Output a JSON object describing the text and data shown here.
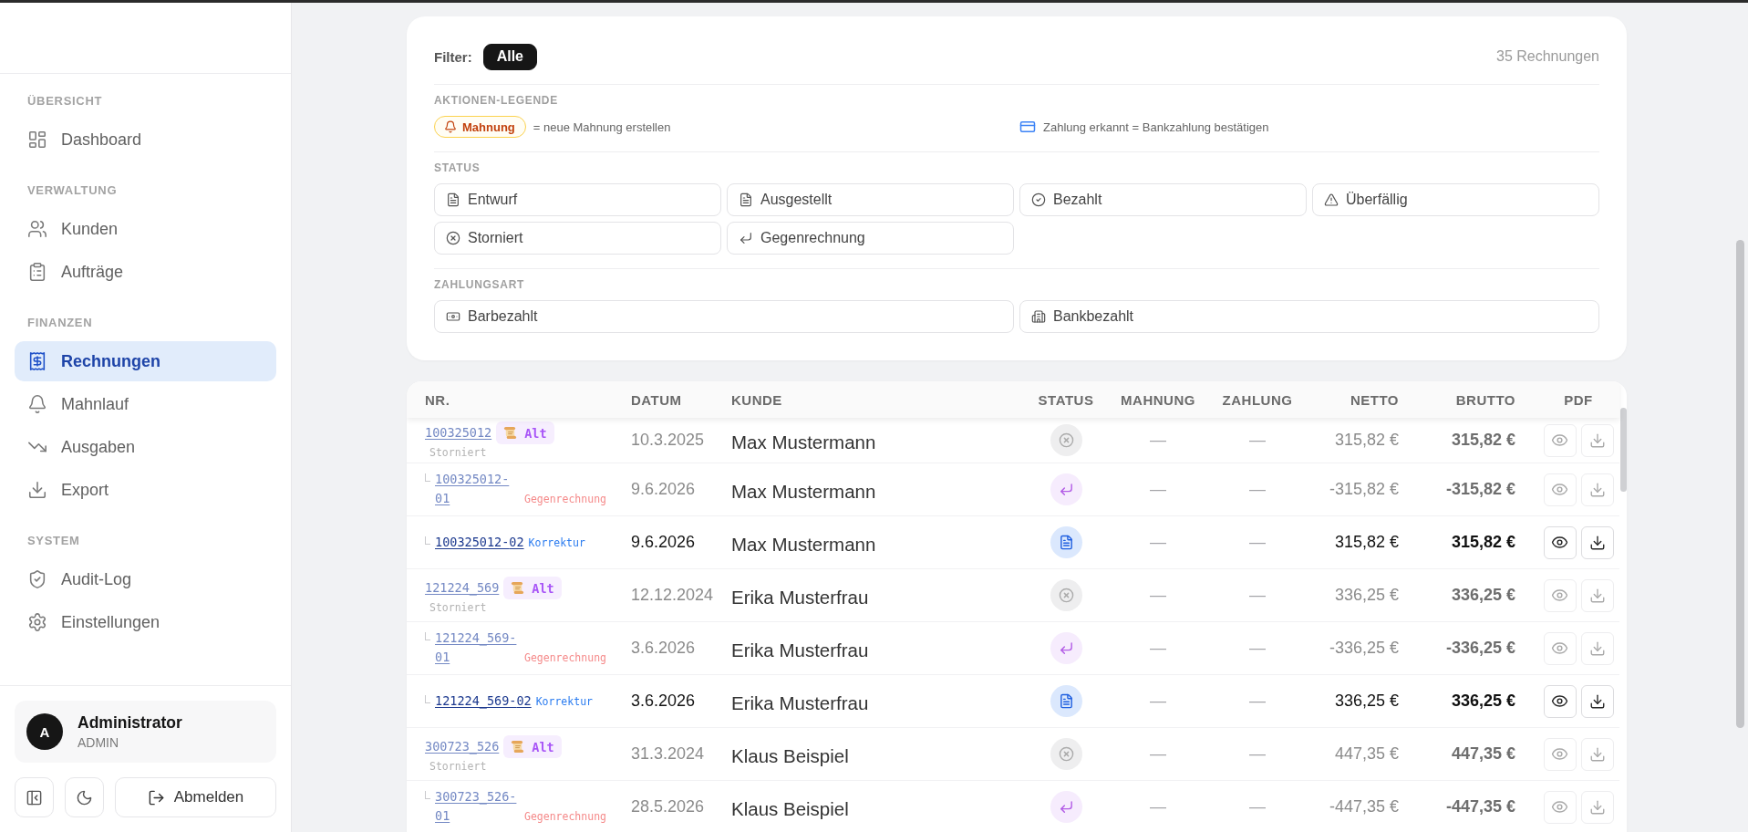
{
  "sidebar": {
    "sections": [
      {
        "label": "ÜBERSICHT",
        "items": [
          {
            "label": "Dashboard",
            "kind": "dashboard",
            "selected": false
          }
        ]
      },
      {
        "label": "VERWALTUNG",
        "items": [
          {
            "label": "Kunden",
            "kind": "customers",
            "selected": false
          },
          {
            "label": "Aufträge",
            "kind": "orders",
            "selected": false
          }
        ]
      },
      {
        "label": "FINANZEN",
        "items": [
          {
            "label": "Rechnungen",
            "kind": "invoices",
            "selected": true
          },
          {
            "label": "Mahnlauf",
            "kind": "reminders",
            "selected": false
          },
          {
            "label": "Ausgaben",
            "kind": "expenses",
            "selected": false
          },
          {
            "label": "Export",
            "kind": "export",
            "selected": false
          }
        ]
      },
      {
        "label": "SYSTEM",
        "items": [
          {
            "label": "Audit-Log",
            "kind": "audit",
            "selected": false
          },
          {
            "label": "Einstellungen",
            "kind": "settings",
            "selected": false
          }
        ]
      }
    ],
    "user": {
      "initial": "A",
      "name": "Administrator",
      "role": "ADMIN"
    },
    "logout": "Abmelden"
  },
  "filter": {
    "label": "Filter:",
    "chips": [
      {
        "label": "Alle",
        "selected": true
      }
    ],
    "count": "35 Rechnungen"
  },
  "legend": {
    "title": "AKTIONEN-LEGENDE",
    "items": [
      {
        "kind": "reminder",
        "badge": "Mahnung",
        "text": "= neue Mahnung erstellen"
      },
      {
        "kind": "payment",
        "text": "Zahlung erkannt = Bankzahlung bestätigen"
      }
    ]
  },
  "status_filter": {
    "title": "STATUS",
    "options": [
      {
        "label": "Entwurf",
        "kind": "draft",
        "selected": false
      },
      {
        "label": "Ausgestellt",
        "kind": "issued",
        "selected": false
      },
      {
        "label": "Bezahlt",
        "kind": "paid",
        "selected": false
      },
      {
        "label": "Überfällig",
        "kind": "overdue",
        "selected": false
      },
      {
        "label": "Storniert",
        "kind": "cancelled",
        "selected": false
      },
      {
        "label": "Gegenrechnung",
        "kind": "credit",
        "selected": false
      }
    ]
  },
  "payment_filter": {
    "title": "ZAHLUNGSART",
    "options": [
      {
        "label": "Barbezahlt",
        "kind": "cash",
        "selected": false
      },
      {
        "label": "Bankbezahlt",
        "kind": "bank",
        "selected": false
      }
    ]
  },
  "table": {
    "columns": [
      "NR.",
      "DATUM",
      "KUNDE",
      "STATUS",
      "MAHNUNG",
      "ZAHLUNG",
      "NETTO",
      "BRUTTO",
      "PDF"
    ],
    "rows": [
      {
        "nr": "100325012",
        "badge": "Alt",
        "note": "Storniert",
        "kind": "cancelled",
        "datum": "10.3.2025",
        "kunde": "Max Mustermann",
        "mahnung": "—",
        "zahlung": "—",
        "netto": "315,82 €",
        "brutto": "315,82 €",
        "children": [
          {
            "nr": "100325012-01",
            "note": "Gegenrechnung",
            "kind": "credit",
            "datum": "9.6.2026",
            "kunde": "Max Mustermann",
            "mahnung": "—",
            "zahlung": "—",
            "netto": "-315,82 €",
            "brutto": "-315,82 €"
          },
          {
            "nr": "100325012-02",
            "note": "Korrektur",
            "kind": "issued",
            "datum": "9.6.2026",
            "kunde": "Max Mustermann",
            "mahnung": "—",
            "zahlung": "—",
            "netto": "315,82 €",
            "brutto": "315,82 €"
          }
        ]
      },
      {
        "nr": "121224_569",
        "badge": "Alt",
        "note": "Storniert",
        "kind": "cancelled",
        "datum": "12.12.2024",
        "kunde": "Erika Musterfrau",
        "mahnung": "—",
        "zahlung": "—",
        "netto": "336,25 €",
        "brutto": "336,25 €",
        "children": [
          {
            "nr": "121224_569-01",
            "note": "Gegenrechnung",
            "kind": "credit",
            "datum": "3.6.2026",
            "kunde": "Erika Musterfrau",
            "mahnung": "—",
            "zahlung": "—",
            "netto": "-336,25 €",
            "brutto": "-336,25 €"
          },
          {
            "nr": "121224_569-02",
            "note": "Korrektur",
            "kind": "issued",
            "datum": "3.6.2026",
            "kunde": "Erika Musterfrau",
            "mahnung": "—",
            "zahlung": "—",
            "netto": "336,25 €",
            "brutto": "336,25 €"
          }
        ]
      },
      {
        "nr": "300723_526",
        "badge": "Alt",
        "note": "Storniert",
        "kind": "cancelled",
        "datum": "31.3.2024",
        "kunde": "Klaus Beispiel",
        "mahnung": "—",
        "zahlung": "—",
        "netto": "447,35 €",
        "brutto": "447,35 €",
        "children": [
          {
            "nr": "300723_526-01",
            "note": "Gegenrechnung",
            "kind": "credit",
            "datum": "28.5.2026",
            "kunde": "Klaus Beispiel",
            "mahnung": "—",
            "zahlung": "—",
            "netto": "-447,35 €",
            "brutto": "-447,35 €"
          }
        ]
      }
    ]
  }
}
